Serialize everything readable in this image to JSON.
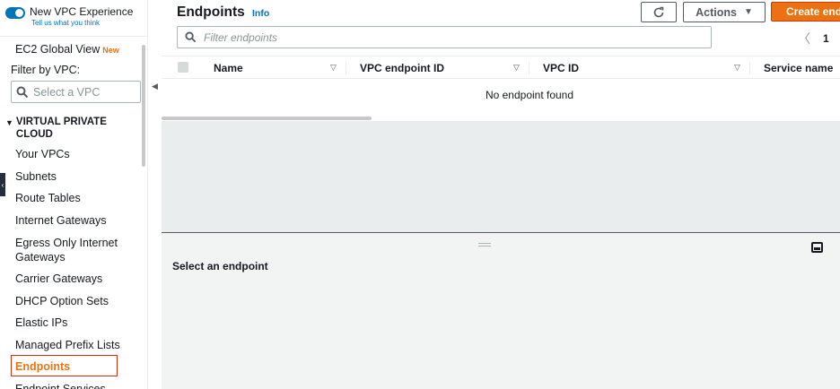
{
  "sidebar": {
    "toggle_title": "New VPC Experience",
    "toggle_link": "Tell us what you think",
    "global_view": "EC2 Global View",
    "new_badge": "New",
    "filter_label": "Filter by VPC:",
    "vpc_placeholder": "Select a VPC",
    "section_title": "VIRTUAL PRIVATE CLOUD",
    "items": [
      "Your VPCs",
      "Subnets",
      "Route Tables",
      "Internet Gateways",
      "Egress Only Internet Gateways",
      "Carrier Gateways",
      "DHCP Option Sets",
      "Elastic IPs",
      "Managed Prefix Lists",
      "Endpoints",
      "Endpoint Services"
    ],
    "active_item": "Endpoints"
  },
  "header": {
    "title": "Endpoints",
    "info": "Info",
    "actions_label": "Actions",
    "create_label": "Create endpoint"
  },
  "filter": {
    "placeholder": "Filter endpoints"
  },
  "pagination": {
    "current_page": "1"
  },
  "table": {
    "columns": [
      "Name",
      "VPC endpoint ID",
      "VPC ID",
      "Service name"
    ],
    "empty_message": "No endpoint found"
  },
  "detail": {
    "title": "Select an endpoint"
  },
  "colors": {
    "accent": "#ec7211",
    "link": "#0073bb",
    "active_border": "#d13212"
  }
}
